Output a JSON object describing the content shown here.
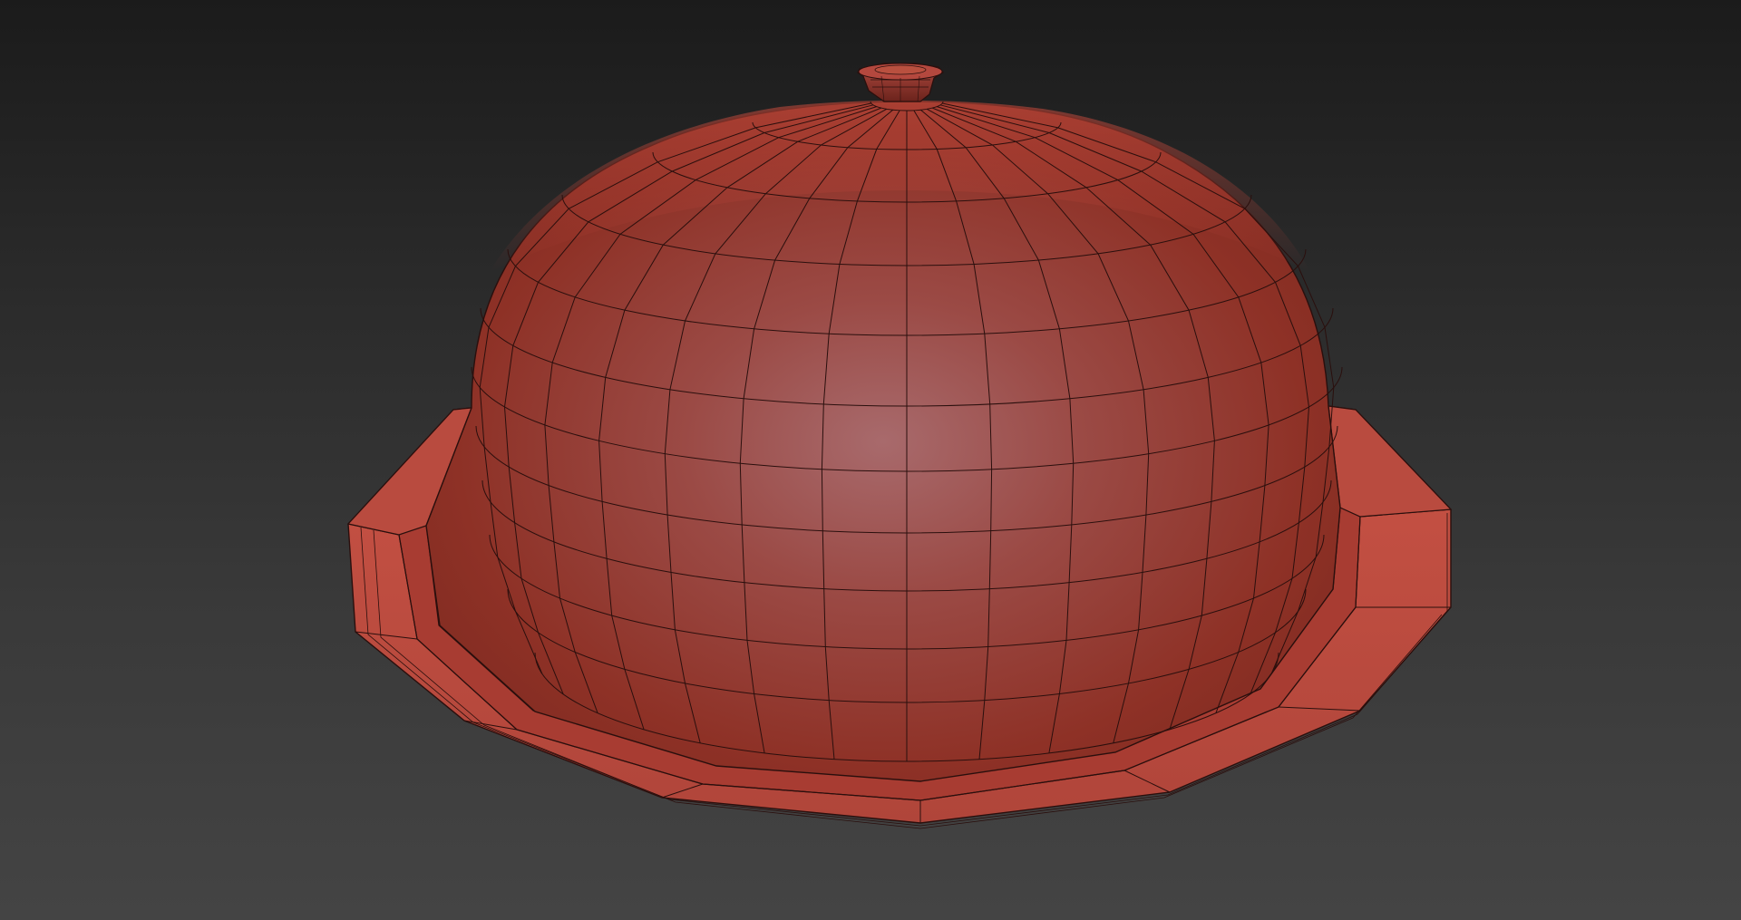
{
  "viewport": {
    "view": "perspective",
    "shading": "smooth-shaded-with-edged-faces",
    "background": {
      "top": "#1b1b1b",
      "bottom": "#444444"
    }
  },
  "model": {
    "object": "dome-cloche-cover",
    "material_color": "#b8473c",
    "wire_color": "#2a0f0d",
    "parts": [
      "knob",
      "dome",
      "flange-rim"
    ],
    "wireframe": true
  }
}
